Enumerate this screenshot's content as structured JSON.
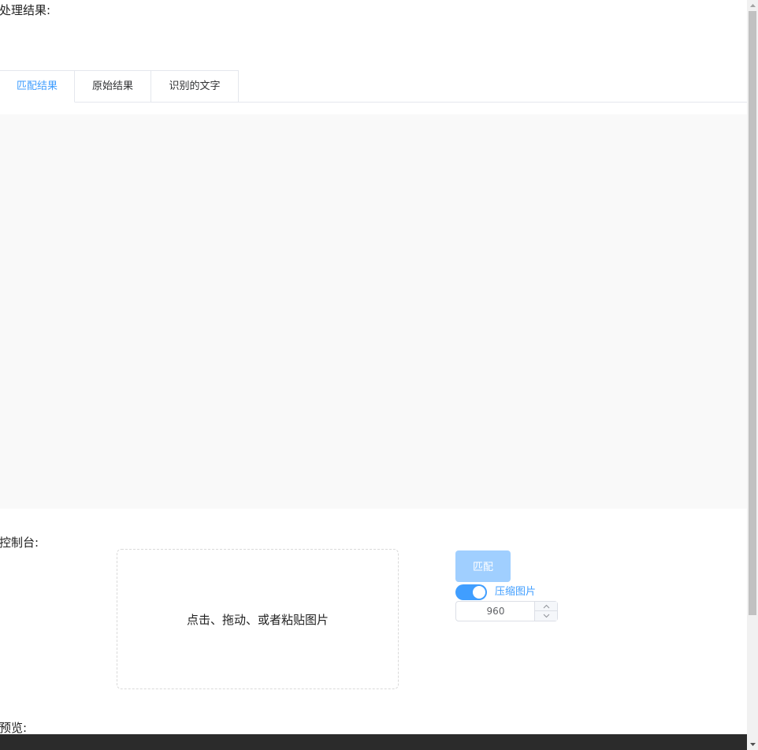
{
  "result_section": {
    "label": "处理结果:"
  },
  "tabs": [
    {
      "label": "匹配结果",
      "active": true
    },
    {
      "label": "原始结果",
      "active": false
    },
    {
      "label": "识别的文字",
      "active": false
    }
  ],
  "console_section": {
    "label": "控制台:",
    "upload_text": "点击、拖动、或者粘贴图片",
    "match_button": "匹配",
    "compress_label": "压缩图片",
    "compress_enabled": true,
    "size_value": "960"
  },
  "preview_section": {
    "label": "预览:"
  },
  "colors": {
    "accent": "#409eff",
    "button_disabled": "#a0cfff"
  }
}
